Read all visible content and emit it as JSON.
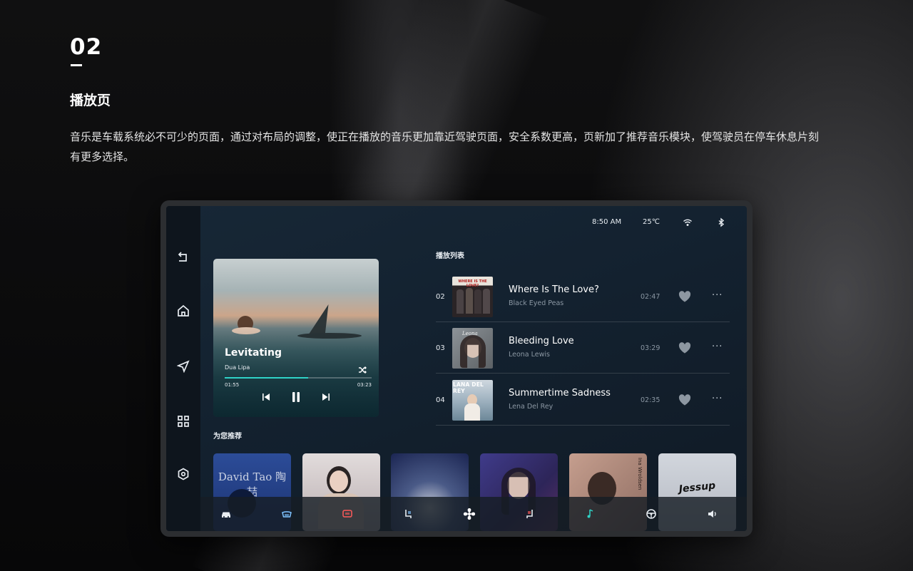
{
  "header": {
    "number": "02",
    "title": "播放页",
    "description": "音乐是车载系统必不可少的页面，通过对布局的调整，使正在播放的音乐更加靠近驾驶页面，安全系数更高，页新加了推荐音乐模块，使驾驶员在停车休息片刻有更多选择。"
  },
  "status_bar": {
    "time": "8:50 AM",
    "temperature": "25℃",
    "icons": [
      "wifi-icon",
      "bluetooth-icon"
    ]
  },
  "sidebar": {
    "items": [
      {
        "icon": "back-icon"
      },
      {
        "icon": "home-icon"
      },
      {
        "icon": "navigation-icon"
      },
      {
        "icon": "apps-grid-icon"
      },
      {
        "icon": "settings-icon"
      }
    ]
  },
  "now_playing": {
    "title": "Levitating",
    "artist": "Dua Lipa",
    "current_time": "01:55",
    "total_time": "03:23",
    "progress": 0.57,
    "accent_color": "#2fd3c7"
  },
  "playlist": {
    "title": "播放列表",
    "items": [
      {
        "index": "02",
        "title": "Where Is The Love?",
        "artist": "Black Eyed Peas",
        "duration": "02:47",
        "cover_text": "WHERE IS THE LOVE?"
      },
      {
        "index": "03",
        "title": "Bleeding Love",
        "artist": "Leona Lewis",
        "duration": "03:29",
        "cover_text": "Leona"
      },
      {
        "index": "04",
        "title": "Summertime Sadness",
        "artist": "Lena Del Rey",
        "duration": "02:35",
        "cover_text": "LANA DEL REY"
      }
    ]
  },
  "recommendations": {
    "title": "为您推荐",
    "items": [
      {
        "label": "David Tao 陶喆",
        "color": "#1f3a7a"
      },
      {
        "label": "",
        "color": "#c9c2c5"
      },
      {
        "label": "",
        "color": "#2d3d6a"
      },
      {
        "label": "",
        "color": "#3a3470"
      },
      {
        "label": "Ina Wroldsen",
        "color": "#a07d6f"
      },
      {
        "label": "Jessup",
        "color": "#c8ccd3"
      }
    ]
  },
  "dock": {
    "items": [
      "car-icon",
      "front-defrost-icon",
      "rear-defrost-icon",
      "seat-heat-left-icon",
      "fan-icon",
      "seat-heat-right-icon",
      "music-icon",
      "steering-wheel-icon",
      "volume-icon"
    ]
  }
}
